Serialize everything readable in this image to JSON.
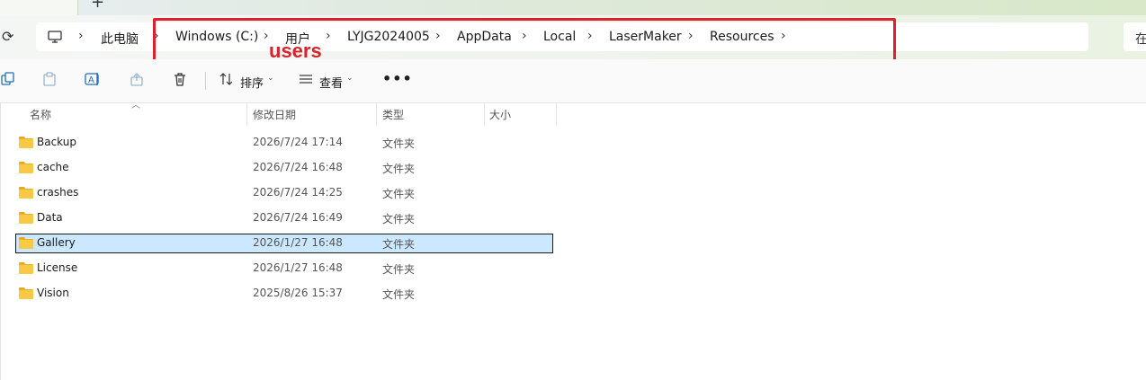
{
  "breadcrumb": [
    "此电脑",
    "Windows (C:)",
    "用户",
    "LYJG2024005",
    "AppData",
    "Local",
    "LaserMaker",
    "Resources"
  ],
  "annotation": {
    "text": "users",
    "color": "#d8222c"
  },
  "search": {
    "label": "在"
  },
  "toolbar": {
    "sort_label": "排序",
    "view_label": "查看",
    "more_label": "•••"
  },
  "columns": {
    "name": "名称",
    "modified": "修改日期",
    "type": "类型",
    "size": "大小"
  },
  "files": [
    {
      "name": "Backup",
      "modified": "2026/7/24 17:14",
      "type": "文件夹",
      "selected": false
    },
    {
      "name": "cache",
      "modified": "2026/7/24 16:48",
      "type": "文件夹",
      "selected": false
    },
    {
      "name": "crashes",
      "modified": "2026/7/24 14:25",
      "type": "文件夹",
      "selected": false
    },
    {
      "name": "Data",
      "modified": "2026/7/24 16:49",
      "type": "文件夹",
      "selected": false
    },
    {
      "name": "Gallery",
      "modified": "2026/1/27 16:48",
      "type": "文件夹",
      "selected": true
    },
    {
      "name": "License",
      "modified": "2026/1/27 16:48",
      "type": "文件夹",
      "selected": false
    },
    {
      "name": "Vision",
      "modified": "2025/8/26 15:37",
      "type": "文件夹",
      "selected": false
    }
  ],
  "colors": {
    "selection": "#cce8ff",
    "folder": "#f8c945",
    "highlight_box": "#e0202c"
  }
}
